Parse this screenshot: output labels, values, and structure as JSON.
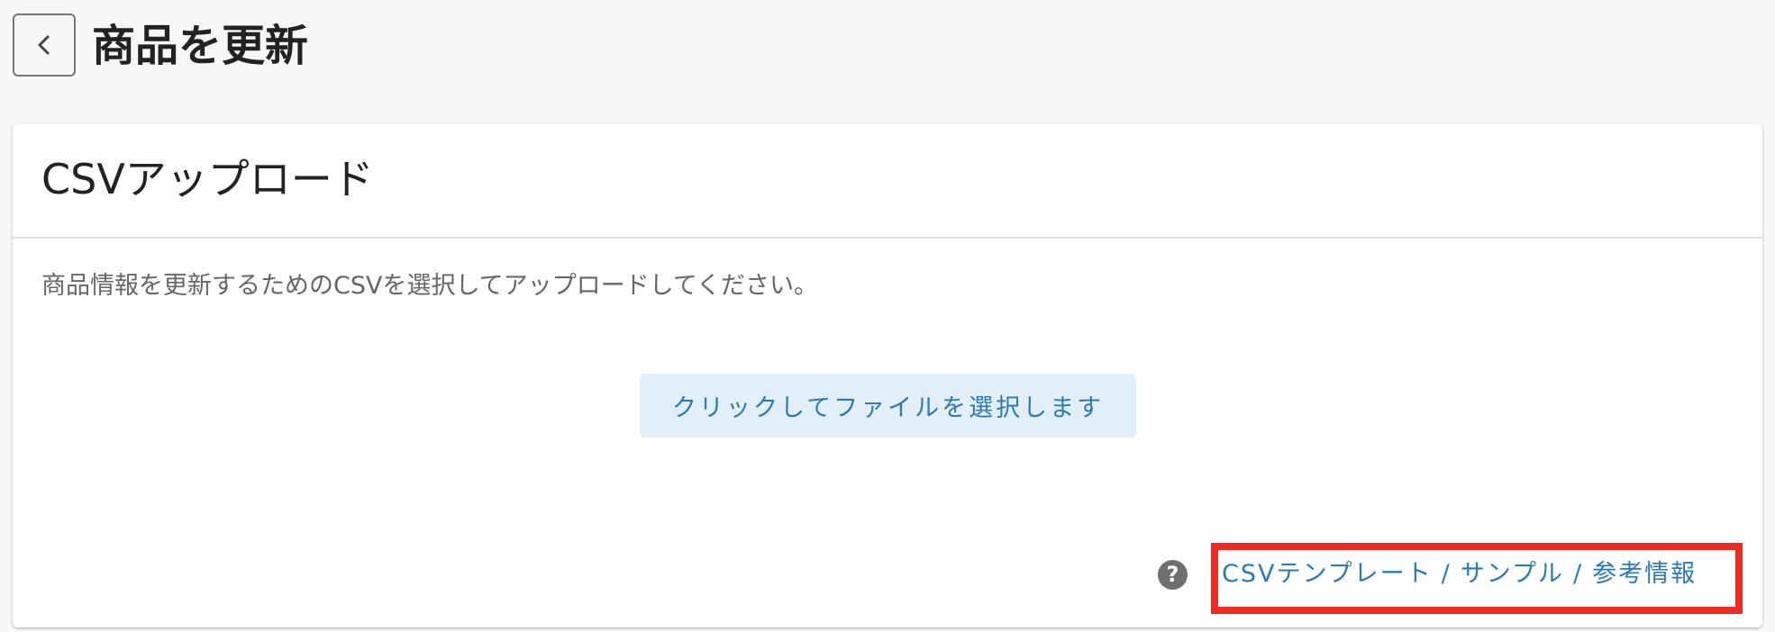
{
  "header": {
    "back_icon": "chevron-left-icon",
    "title": "商品を更新"
  },
  "card": {
    "title": "CSVアップロード",
    "description": "商品情報を更新するためのCSVを選択してアップロードしてください。",
    "file_select_label": "クリックしてファイルを選択します",
    "help_icon": "question-circle-icon",
    "help_icon_glyph": "?",
    "links": {
      "template": "CSVテンプレート",
      "separator": "/",
      "sample": "サンプル",
      "reference": "参考情報"
    }
  },
  "colors": {
    "link": "#2a7ab8",
    "button_bg": "#e3eff8",
    "highlight": "#ee2a22",
    "background": "#f7f7f7"
  }
}
